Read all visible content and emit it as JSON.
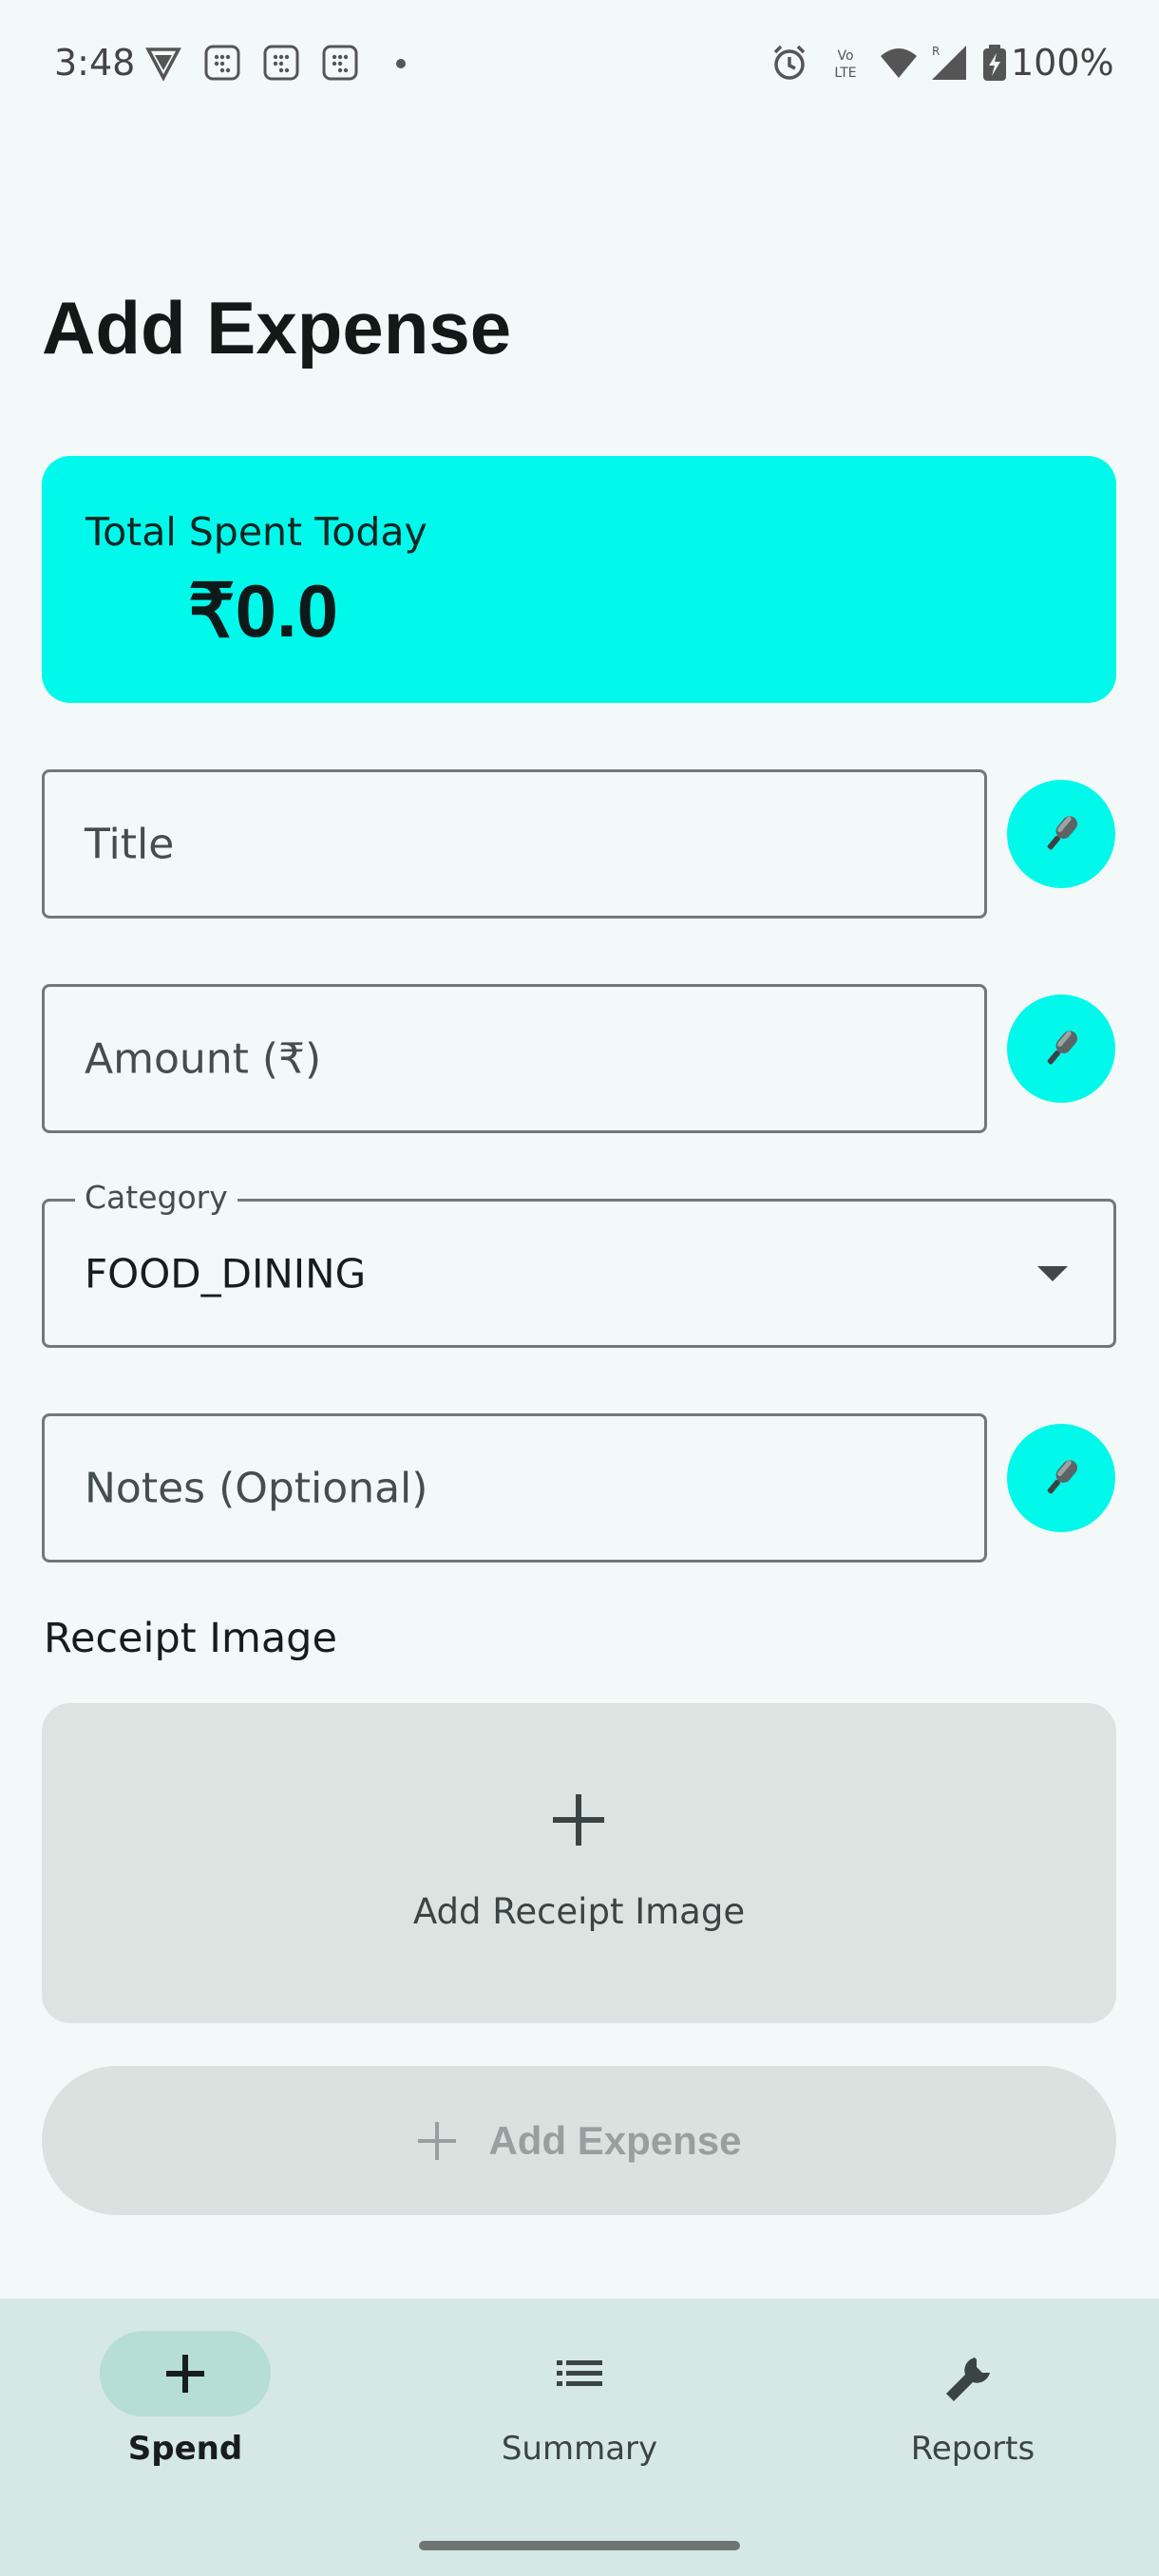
{
  "status_bar": {
    "time": "3:48",
    "battery": "100%",
    "icons": [
      "vpn-icon",
      "app-notification-icon",
      "app-notification-icon",
      "app-notification-icon",
      "dot-icon",
      "alarm-icon",
      "volte-icon",
      "wifi-icon",
      "signal-icon",
      "battery-charging-icon"
    ]
  },
  "page": {
    "title": "Add Expense"
  },
  "summary": {
    "label": "Total Spent Today",
    "value": "₹0.0",
    "color": "#00f9ea"
  },
  "form": {
    "title_placeholder": "Title",
    "amount_placeholder": "Amount (₹)",
    "category_label": "Category",
    "category_value": "FOOD_DINING",
    "notes_placeholder": "Notes (Optional)",
    "mic_icon": "microphone-icon"
  },
  "receipt": {
    "section_label": "Receipt Image",
    "add_label": "Add Receipt Image"
  },
  "submit": {
    "label": "Add Expense",
    "enabled": false
  },
  "bottom_nav": {
    "items": [
      {
        "label": "Spend",
        "icon": "plus-icon",
        "active": true
      },
      {
        "label": "Summary",
        "icon": "list-icon",
        "active": false
      },
      {
        "label": "Reports",
        "icon": "wrench-icon",
        "active": false
      }
    ]
  }
}
